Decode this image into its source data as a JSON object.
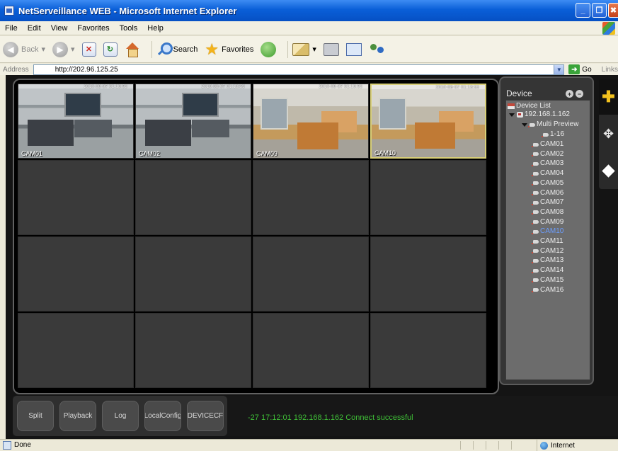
{
  "window": {
    "title": "NetServeillance WEB - Microsoft Internet Explorer",
    "buttons": [
      "_",
      "❐",
      "✖"
    ]
  },
  "menu": [
    "File",
    "Edit",
    "View",
    "Favorites",
    "Tools",
    "Help"
  ],
  "toolbar": {
    "back_label": "Back",
    "search_label": "Search",
    "favorites_label": "Favorites"
  },
  "address": {
    "label": "Address",
    "url": "http://202.96.125.25",
    "go_label": "Go",
    "links_label": "Links"
  },
  "grid": {
    "cells": [
      {
        "label": "CAM01",
        "timestamp": "2010-08-07 01:18:53",
        "has_video": true
      },
      {
        "label": "CAM02",
        "timestamp": "2010-08-07 01:18:53",
        "has_video": true
      },
      {
        "label": "CAM09",
        "timestamp": "2010-08-07 01:18:53",
        "has_video": true
      },
      {
        "label": "CAM10",
        "timestamp": "2010-08-07 01:18:53",
        "has_video": true,
        "selected": true
      },
      {
        "label": "",
        "timestamp": "",
        "has_video": false
      },
      {
        "label": "",
        "timestamp": "",
        "has_video": false
      },
      {
        "label": "",
        "timestamp": "",
        "has_video": false
      },
      {
        "label": "",
        "timestamp": "",
        "has_video": false
      },
      {
        "label": "",
        "timestamp": "",
        "has_video": false
      },
      {
        "label": "",
        "timestamp": "",
        "has_video": false
      },
      {
        "label": "",
        "timestamp": "",
        "has_video": false
      },
      {
        "label": "",
        "timestamp": "",
        "has_video": false
      },
      {
        "label": "",
        "timestamp": "",
        "has_video": false
      },
      {
        "label": "",
        "timestamp": "",
        "has_video": false
      },
      {
        "label": "",
        "timestamp": "",
        "has_video": false
      },
      {
        "label": "",
        "timestamp": "",
        "has_video": false
      }
    ]
  },
  "device_panel": {
    "title": "Device",
    "add": "+",
    "remove": "−",
    "tree": {
      "root": "Device List",
      "device": "192.168.1.162",
      "group": "Multi Preview",
      "subgroup": "1-16",
      "cameras": [
        "CAM01",
        "CAM02",
        "CAM03",
        "CAM04",
        "CAM05",
        "CAM06",
        "CAM07",
        "CAM08",
        "CAM09",
        "CAM10",
        "CAM11",
        "CAM12",
        "CAM13",
        "CAM14",
        "CAM15",
        "CAM16"
      ],
      "active_camera": "CAM10"
    }
  },
  "tools": {
    "ptz_icon": "ptz-control-icon",
    "move_icon": "move-icon",
    "color_icon": "diamond-icon"
  },
  "bottom": {
    "buttons": [
      "Split",
      "Playback",
      "Log",
      "LocalConfig",
      "DEVICECF"
    ],
    "status": "-27 17:12:01  192.168.1.162  Connect successful"
  },
  "statusbar": {
    "left": "Done",
    "zone": "Internet"
  }
}
